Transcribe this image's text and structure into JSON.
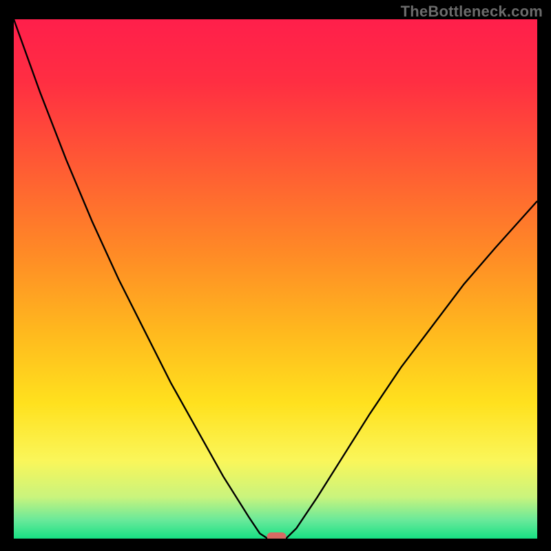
{
  "watermark": "TheBottleneck.com",
  "chart_data": {
    "type": "line",
    "title": "",
    "xlabel": "",
    "ylabel": "",
    "xlim": [
      0,
      100
    ],
    "ylim": [
      0,
      100
    ],
    "grid": false,
    "legend": false,
    "series": [
      {
        "name": "left-curve",
        "x": [
          0,
          5,
          10,
          15,
          20,
          25,
          30,
          35,
          40,
          45,
          47,
          48.5
        ],
        "y": [
          100,
          86,
          73,
          61,
          50,
          40,
          30,
          21,
          12,
          4,
          1,
          0
        ]
      },
      {
        "name": "right-curve",
        "x": [
          52,
          54,
          58,
          63,
          68,
          74,
          80,
          86,
          92,
          100
        ],
        "y": [
          0,
          2,
          8,
          16,
          24,
          33,
          41,
          49,
          56,
          65
        ]
      }
    ],
    "annotations": [
      {
        "name": "minimum-marker",
        "shape": "pill",
        "x": 50.2,
        "y": 0.4,
        "color": "#d66a63"
      }
    ],
    "background_gradient": {
      "stops": [
        {
          "offset": 0.0,
          "color": "#ff1f4b"
        },
        {
          "offset": 0.12,
          "color": "#ff2e42"
        },
        {
          "offset": 0.28,
          "color": "#ff5a34"
        },
        {
          "offset": 0.45,
          "color": "#ff8a26"
        },
        {
          "offset": 0.6,
          "color": "#ffb81e"
        },
        {
          "offset": 0.74,
          "color": "#ffe11e"
        },
        {
          "offset": 0.85,
          "color": "#faf65a"
        },
        {
          "offset": 0.92,
          "color": "#c9f47d"
        },
        {
          "offset": 0.965,
          "color": "#68e99a"
        },
        {
          "offset": 1.0,
          "color": "#17e083"
        }
      ]
    }
  }
}
